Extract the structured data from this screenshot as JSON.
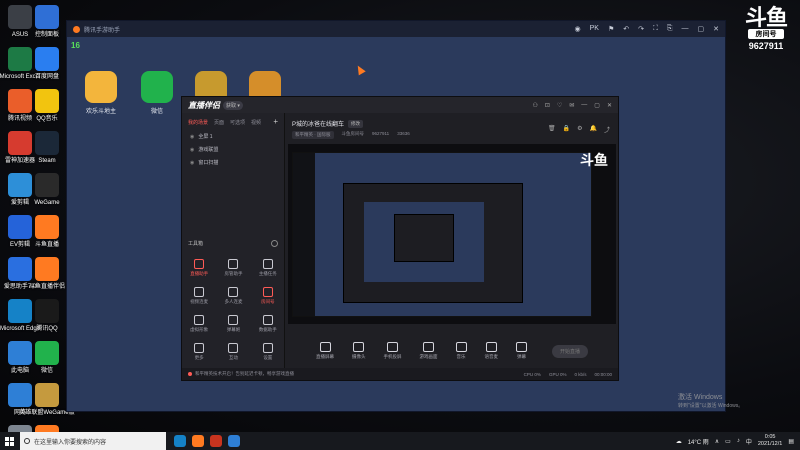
{
  "brand": {
    "logo": "斗鱼",
    "sub": "房间号",
    "room_number": "9627911"
  },
  "desktop_icons": [
    {
      "label": "ASUS",
      "color": "#3b3f46"
    },
    {
      "label": "控制面板",
      "color": "#2f6fd6"
    },
    {
      "label": "Microsoft Excel",
      "color": "#1d7a45"
    },
    {
      "label": "百度网盘",
      "color": "#2a7ef0"
    },
    {
      "label": "腾讯视频",
      "color": "#ea5e2a"
    },
    {
      "label": "QQ音乐",
      "color": "#f2c40f"
    },
    {
      "label": "雷神加速器",
      "color": "#d63b2f"
    },
    {
      "label": "Steam",
      "color": "#1b2838"
    },
    {
      "label": "爱剪辑",
      "color": "#2d8fd8"
    },
    {
      "label": "WeGame",
      "color": "#2a2a2a"
    },
    {
      "label": "EV剪辑",
      "color": "#2563d9"
    },
    {
      "label": "斗鱼直播",
      "color": "#ff7a21"
    },
    {
      "label": "爱思助手7.0",
      "color": "#2a6fe0"
    },
    {
      "label": "斗鱼直播伴侣",
      "color": "#ff7a21"
    },
    {
      "label": "Microsoft Edge",
      "color": "#1582c7"
    },
    {
      "label": "腾讯QQ",
      "color": "#1a1a1a"
    },
    {
      "label": "此电脑",
      "color": "#2e7fd6"
    },
    {
      "label": "微信",
      "color": "#21b24c"
    },
    {
      "label": "网络",
      "color": "#2e7fd6"
    },
    {
      "label": "英雄联盟WeGame版",
      "color": "#c59a3e"
    },
    {
      "label": "回收站",
      "color": "#7d8590"
    },
    {
      "label": "master_0...",
      "color": "#ff7a21"
    }
  ],
  "outer_window": {
    "title": "腾讯手游助手",
    "count": "16",
    "controls": [
      "◉",
      "PK",
      "⚑",
      "↶",
      "↷",
      "⛶",
      "⎘",
      "—",
      "▢",
      "✕"
    ],
    "apps": [
      {
        "label": "欢乐斗地主",
        "color": "#f3b53c"
      },
      {
        "label": "微信",
        "color": "#21b24c"
      },
      {
        "label": "",
        "color": "#c79a2e"
      },
      {
        "label": "",
        "color": "#d58e2a"
      }
    ]
  },
  "inner_window": {
    "logo": "直播伴侣",
    "badge": "获取 ▾",
    "controls": [
      "⚇",
      "⊡",
      "♡",
      "✉",
      "—",
      "▢",
      "✕"
    ],
    "tabs": [
      "我的场景",
      "页面",
      "可选项",
      "视频",
      "+"
    ],
    "scenes": [
      "全屏 1",
      "游戏联盟",
      "窗口扫描"
    ],
    "tools_title": "工具箱",
    "tools": [
      {
        "label": "直播助手",
        "red": true
      },
      {
        "label": "房管助手",
        "red": false
      },
      {
        "label": "主播任务",
        "red": false
      },
      {
        "label": "视频连麦",
        "red": false
      },
      {
        "label": "多人连麦",
        "red": false
      },
      {
        "label": "房间号",
        "red": true
      },
      {
        "label": "虚拟形象",
        "red": false
      },
      {
        "label": "弹幕姬",
        "red": false
      },
      {
        "label": "数据助手",
        "red": false
      },
      {
        "label": "更多",
        "red": false
      },
      {
        "label": "互动",
        "red": false
      },
      {
        "label": "设置",
        "red": false
      }
    ],
    "room_title": "P城的冰爸在线翻车",
    "room_tag": "修改",
    "room_category": "和平精英 · 国际服",
    "room_meta_1": "9627911",
    "room_meta_2": "33636",
    "room_meta_label_1": "斗鱼房间号",
    "actions": [
      "直播屏幕",
      "摄像头",
      "手机投屏",
      "游戏画面",
      "音乐",
      "语音麦",
      "弹幕"
    ],
    "go_live": "开始直播",
    "status_text": "和平精英技术开启！告别延迟卡顿，畅享游戏直播",
    "stats": [
      "CPU 0%",
      "GPU 0%",
      "0 kb/s",
      "00:00:00"
    ]
  },
  "watermark": {
    "line1": "激活 Windows",
    "line2": "转到\"设置\"以激活 Windows。"
  },
  "taskbar": {
    "search_placeholder": "在这里输入你要搜索的内容",
    "apps": [
      "#1582c7",
      "#ff7a21",
      "#c8341f",
      "#2e7fd6"
    ],
    "weather": "14°C 雨",
    "time": "0:05",
    "date": "2021/12/1"
  }
}
